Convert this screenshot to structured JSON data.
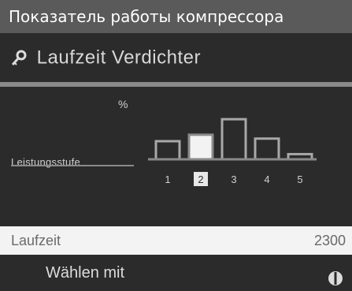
{
  "header": {
    "title": "Показатель работы компрессора"
  },
  "subheader": {
    "label": "Laufzeit Verdichter",
    "icon": "key-icon"
  },
  "chart": {
    "y_unit": "%",
    "side_label": "Leistungsstufe",
    "selected_category": "2"
  },
  "chart_data": {
    "type": "bar",
    "categories": [
      "1",
      "2",
      "3",
      "4",
      "5"
    ],
    "values": [
      28,
      38,
      62,
      32,
      8
    ],
    "ylim": [
      0,
      100
    ],
    "grid": false,
    "selected_index": 1
  },
  "footer_row": {
    "label": "Laufzeit",
    "value": "2300"
  },
  "bottom": {
    "select_text": "Wählen mit",
    "icon": "rotary-knob-icon"
  },
  "colors": {
    "title_bg": "#5a5a5a",
    "screen_bg": "#2b2b2b",
    "bar_outline": "#a8a8a8",
    "bar_selected": "#f2f2f2",
    "row_bg": "#f3f3f3"
  }
}
